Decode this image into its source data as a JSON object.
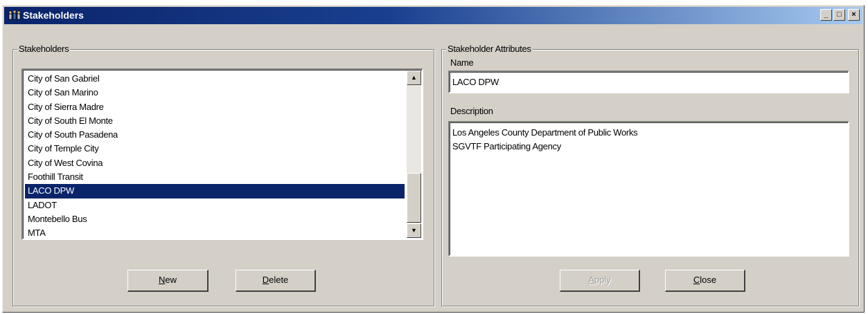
{
  "window": {
    "title": "Stakeholders",
    "controls": {
      "minimize": "_",
      "maximize": "□",
      "close": "×"
    }
  },
  "left_group": {
    "label": "Stakeholders",
    "items": [
      "City of San Gabriel",
      "City of San Marino",
      "City of Sierra Madre",
      "City of South El Monte",
      "City of South Pasadena",
      "City of Temple City",
      "City of West Covina",
      "Foothill Transit",
      "LACO DPW",
      "LADOT",
      "Montebello Bus",
      "MTA"
    ],
    "selected_index": 8,
    "scroll": {
      "up_glyph": "▲",
      "down_glyph": "▼"
    },
    "new_label": "New",
    "new_access_key": "N",
    "delete_label": "Delete",
    "delete_access_key": "D"
  },
  "right_group": {
    "label": "Stakeholder Attributes",
    "name_label": "Name",
    "name_value": "LACO DPW",
    "description_label": "Description",
    "description_lines": [
      "Los Angeles County Department of Public Works",
      "SGVTF Participating Agency"
    ],
    "apply_label": "Apply",
    "apply_access_key": "A",
    "close_label": "Close",
    "close_access_key": "C"
  },
  "colors": {
    "title_bar": "#0a246a",
    "selection": "#0a246a",
    "face": "#d4d0c8"
  }
}
